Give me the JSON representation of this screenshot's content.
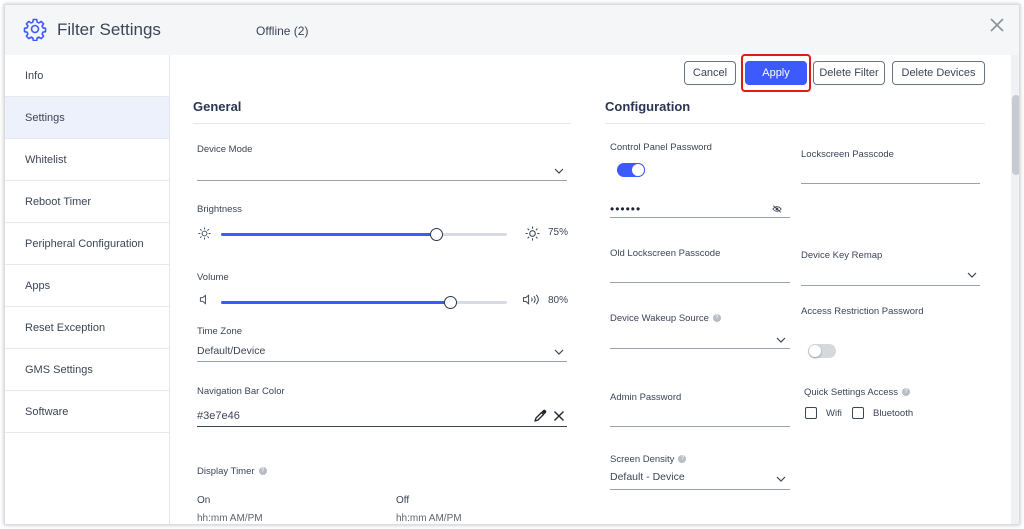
{
  "header": {
    "title": "Filter Settings",
    "status": "Offline (2)"
  },
  "sidebar": {
    "items": [
      {
        "label": "Info",
        "active": false
      },
      {
        "label": "Settings",
        "active": true
      },
      {
        "label": "Whitelist",
        "active": false
      },
      {
        "label": "Reboot Timer",
        "active": false
      },
      {
        "label": "Peripheral Configuration",
        "active": false
      },
      {
        "label": "Apps",
        "active": false
      },
      {
        "label": "Reset Exception",
        "active": false
      },
      {
        "label": "GMS Settings",
        "active": false
      },
      {
        "label": "Software",
        "active": false
      }
    ]
  },
  "toolbar": {
    "cancel": "Cancel",
    "apply": "Apply",
    "delete_filter": "Delete Filter",
    "delete_devices": "Delete Devices"
  },
  "general": {
    "title": "General",
    "device_mode": {
      "label": "Device Mode",
      "value": ""
    },
    "brightness": {
      "label": "Brightness",
      "value": 75,
      "display": "75%"
    },
    "volume": {
      "label": "Volume",
      "value": 80,
      "display": "80%"
    },
    "time_zone": {
      "label": "Time Zone",
      "value": "Default/Device"
    },
    "nav_bar_color": {
      "label": "Navigation Bar Color",
      "value": "#3e7e46"
    },
    "display_timer": {
      "label": "Display Timer",
      "on_label": "On",
      "off_label": "Off",
      "on_placeholder": "hh:mm AM/PM",
      "off_placeholder": "hh:mm AM/PM"
    }
  },
  "configuration": {
    "title": "Configuration",
    "control_panel_password": {
      "label": "Control Panel Password",
      "enabled": true,
      "value": "••••••"
    },
    "lockscreen_passcode": {
      "label": "Lockscreen Passcode",
      "value": ""
    },
    "old_lockscreen_passcode": {
      "label": "Old Lockscreen Passcode",
      "value": ""
    },
    "device_key_remap": {
      "label": "Device Key Remap",
      "value": ""
    },
    "device_wakeup_source": {
      "label": "Device Wakeup Source",
      "value": ""
    },
    "access_restriction_password": {
      "label": "Access Restriction Password",
      "enabled": false
    },
    "admin_password": {
      "label": "Admin Password",
      "value": ""
    },
    "quick_settings_access": {
      "label": "Quick Settings Access",
      "wifi_label": "Wifi",
      "wifi_checked": false,
      "bluetooth_label": "Bluetooth",
      "bluetooth_checked": false
    },
    "screen_density": {
      "label": "Screen Density",
      "value": "Default - Device"
    }
  },
  "colors": {
    "accent": "#3d5afe",
    "highlight": "#e01919",
    "sidebar_active": "#edf1fb"
  }
}
